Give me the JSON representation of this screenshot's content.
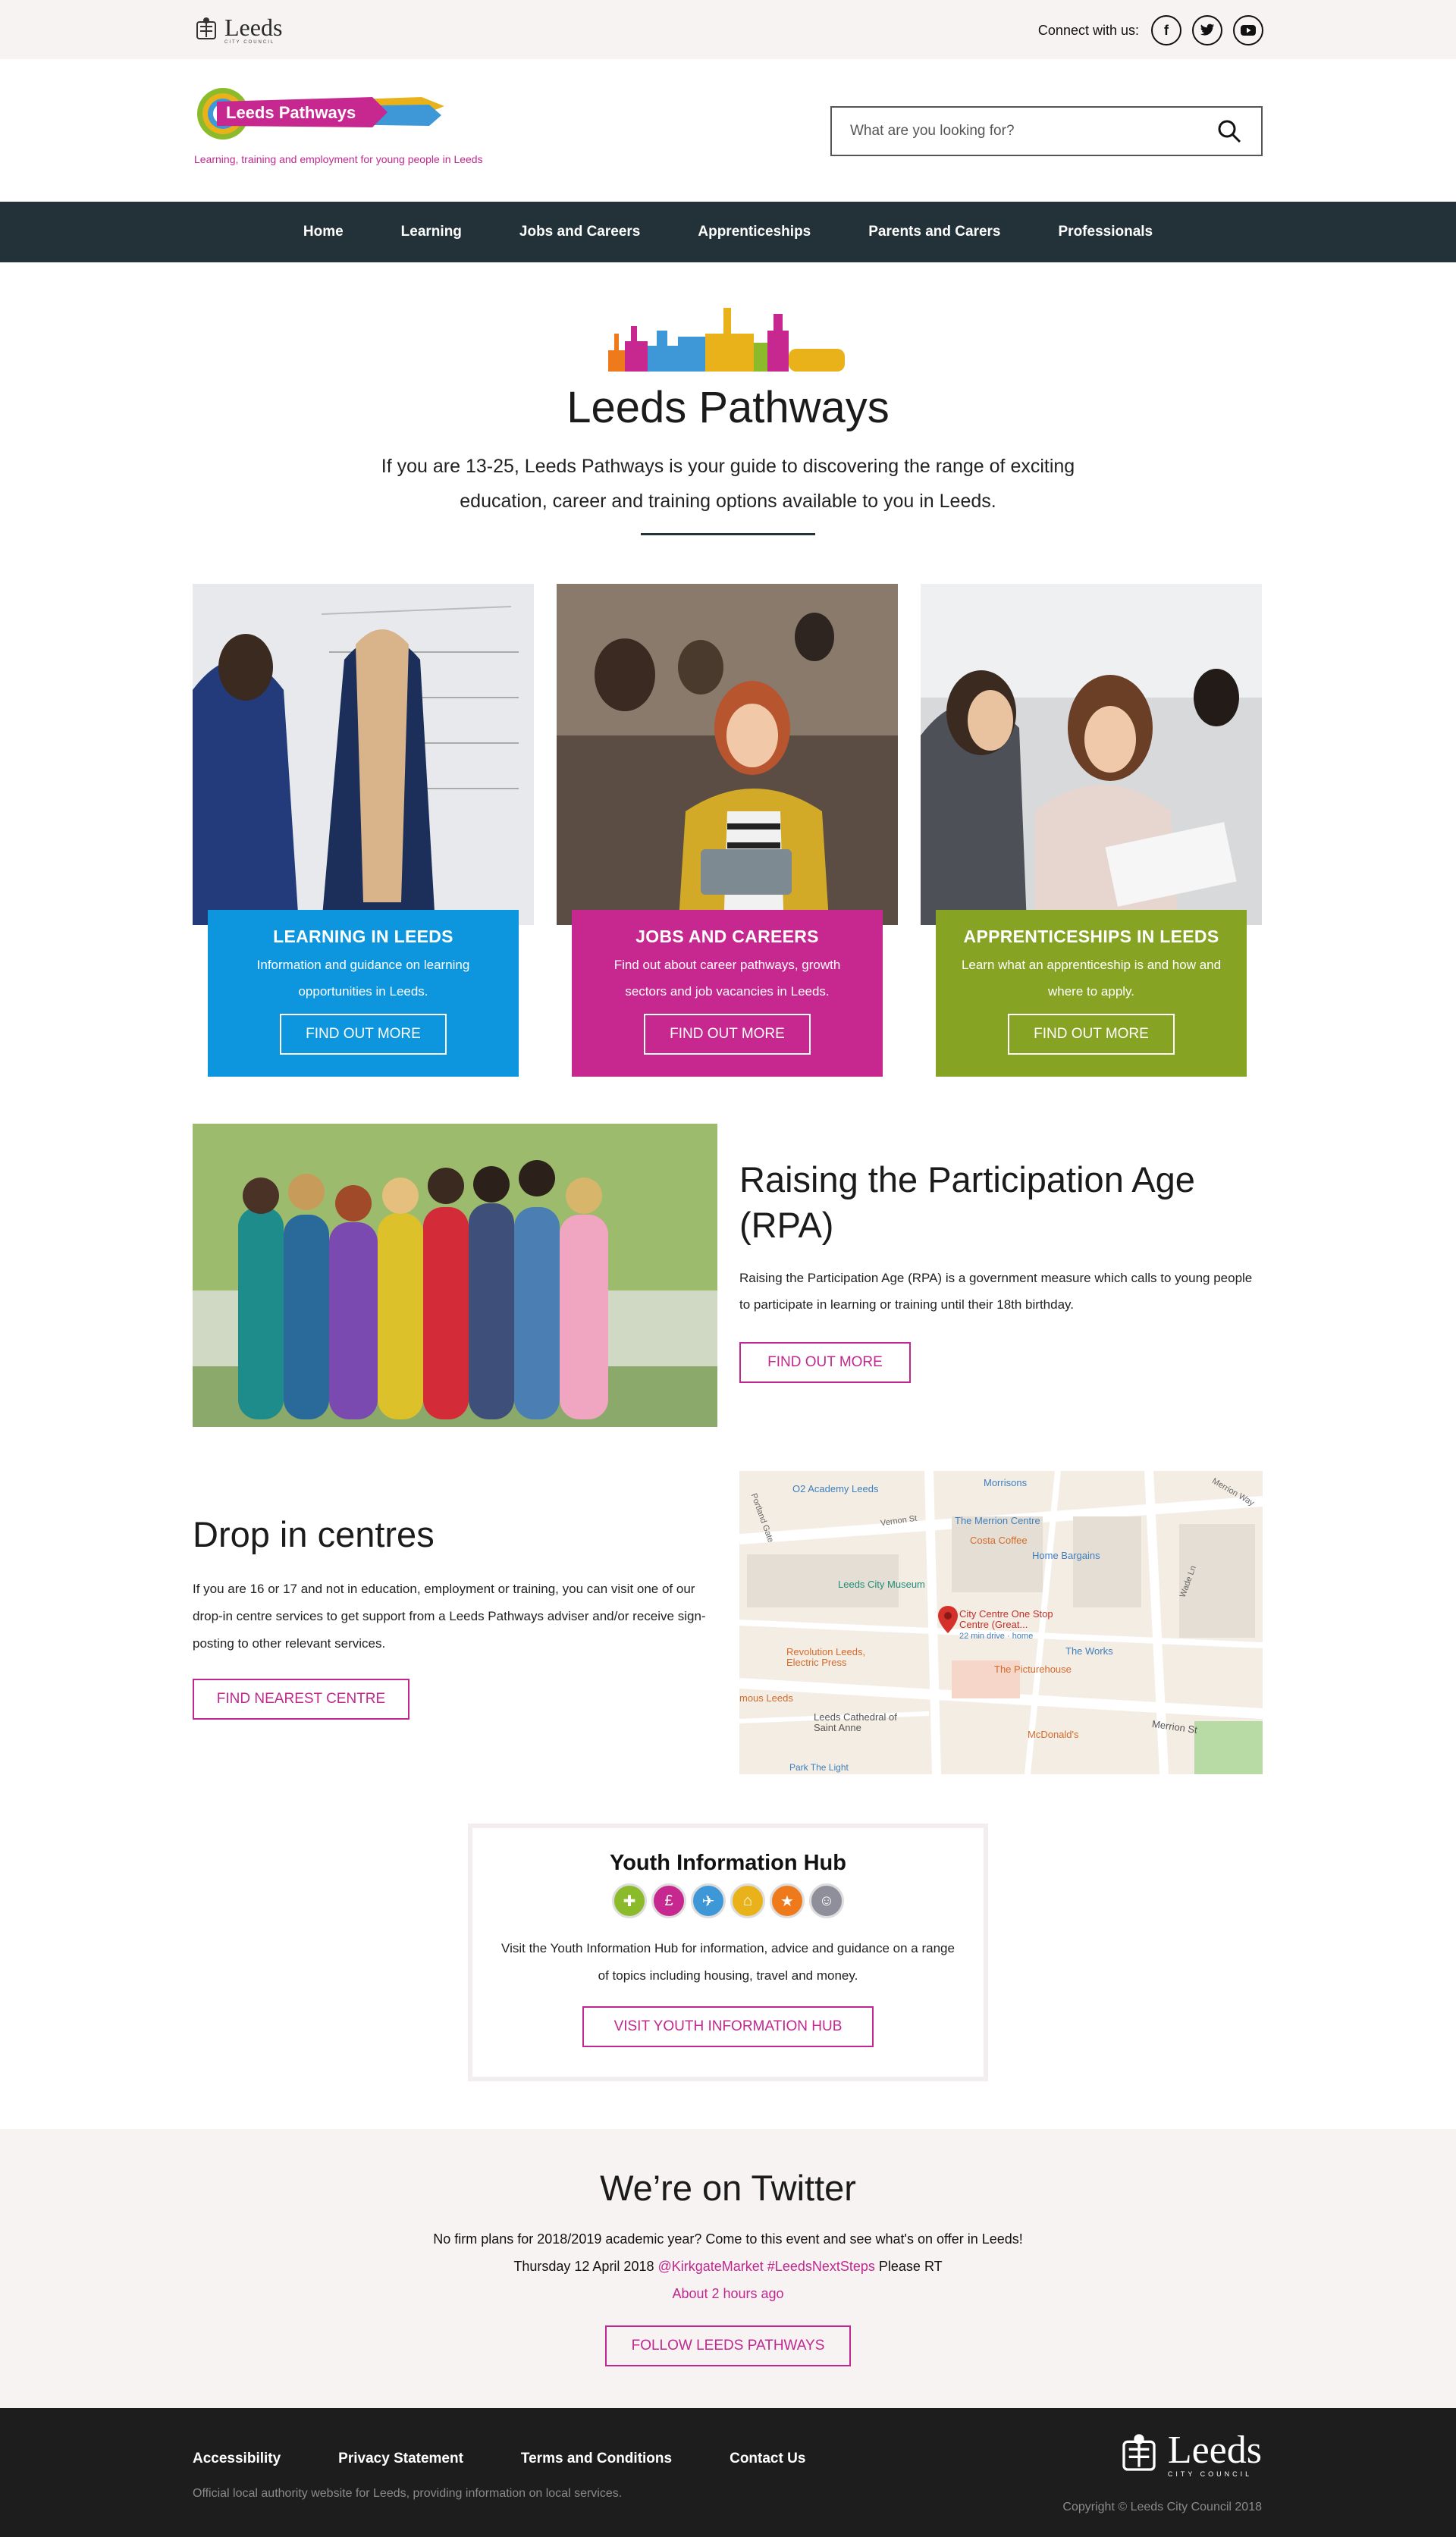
{
  "topbar": {
    "council_logo_text": "Leeds",
    "council_logo_sub": "CITY COUNCIL",
    "connect_label": "Connect with us:",
    "social": [
      {
        "icon": "facebook-icon",
        "glyph": "f"
      },
      {
        "icon": "twitter-icon",
        "glyph": "t"
      },
      {
        "icon": "youtube-icon",
        "glyph": "▶"
      }
    ]
  },
  "header": {
    "logo_text": "Leeds Pathways",
    "tagline": "Learning, training and employment for young people in Leeds",
    "search_placeholder": "What are you looking for?"
  },
  "nav": {
    "items": [
      "Home",
      "Learning",
      "Jobs and Careers",
      "Apprenticeships",
      "Parents and Carers",
      "Professionals"
    ]
  },
  "intro": {
    "title": "Leeds Pathways",
    "text": "If you are 13-25, Leeds Pathways is your guide to discovering the range of exciting education, career and training options available to you in Leeds."
  },
  "cards": [
    {
      "title": "LEARNING IN LEEDS",
      "desc": "Information and guidance on learning opportunities in Leeds.",
      "button": "FIND OUT MORE",
      "color": "#0d96dd"
    },
    {
      "title": "JOBS AND CAREERS",
      "desc": "Find out about career pathways, growth sectors and job vacancies in Leeds.",
      "button": "FIND OUT MORE",
      "color": "#c6288f"
    },
    {
      "title": "APPRENTICESHIPS IN LEEDS",
      "desc": "Learn what an apprenticeship is and how and where to apply.",
      "button": "FIND OUT MORE",
      "color": "#86a323"
    }
  ],
  "rpa": {
    "title": "Raising the Participation Age (RPA)",
    "text": "Raising the Participation Age (RPA) is a government measure which calls to young people to participate in learning or training until their 18th birthday.",
    "button": "FIND OUT MORE"
  },
  "drop_in": {
    "title": "Drop in centres",
    "text": "If you are 16 or 17 and not in education, employment or training, you can visit one of our drop-in centre services to get support from a Leeds Pathways adviser and/or receive sign-posting to other relevant services.",
    "button": "FIND NEAREST CENTRE",
    "map_labels": {
      "o2": "O2 Academy Leeds",
      "morrisons": "Morrisons",
      "merrion_centre": "The Merrion Centre",
      "costa": "Costa Coffee",
      "home_bargains": "Home Bargains",
      "museum": "Leeds City Museum",
      "pin": "City Centre One Stop Centre (Great...",
      "pin_sub": "22 min drive · home",
      "revolution": "Revolution Leeds, Electric Press",
      "works": "The Works",
      "picturehouse": "The Picturehouse",
      "cathedral": "Leeds Cathedral of Saint Anne",
      "mcdonalds": "McDonald's",
      "merrion_st": "Merrion St",
      "mous": "mous Leeds",
      "park": "Park The Light",
      "vernon": "Vernon St",
      "portland": "Portland Gate",
      "merrion_way": "Merrion Way",
      "wade": "Wade Ln"
    }
  },
  "hub": {
    "title": "Youth Information Hub",
    "text": "Visit the Youth Information Hub for information, advice and guidance on a range of topics including housing, travel and money.",
    "button": "VISIT YOUTH INFORMATION HUB",
    "icons": [
      {
        "name": "health-icon",
        "glyph": "✚",
        "color": "#8bbb2a"
      },
      {
        "name": "money-icon",
        "glyph": "£",
        "color": "#c6288f"
      },
      {
        "name": "travel-icon",
        "glyph": "✈",
        "color": "#3e97d6"
      },
      {
        "name": "housing-icon",
        "glyph": "⌂",
        "color": "#e9b21a"
      },
      {
        "name": "activities-icon",
        "glyph": "★",
        "color": "#ee7a1c"
      },
      {
        "name": "people-icon",
        "glyph": "☺",
        "color": "#8f8f9b"
      }
    ]
  },
  "twitter": {
    "title": "We’re on Twitter",
    "line1": "No firm plans for 2018/2019 academic year? Come to this event and see what's on offer in Leeds!",
    "line2_prefix": "Thursday 12 April 2018 ",
    "line2_link": "@KirkgateMarket #LeedsNextSteps",
    "line2_suffix": " Please RT",
    "time": "About 2 hours ago",
    "button": "FOLLOW LEEDS PATHWAYS"
  },
  "footer": {
    "links": [
      "Accessibility",
      "Privacy Statement",
      "Terms and Conditions",
      "Contact Us"
    ],
    "note": "Official local authority website for Leeds, providing information on local services.",
    "logo_text": "Leeds",
    "logo_sub": "CITY COUNCIL",
    "copyright": "Copyright © Leeds City Council 2018"
  }
}
